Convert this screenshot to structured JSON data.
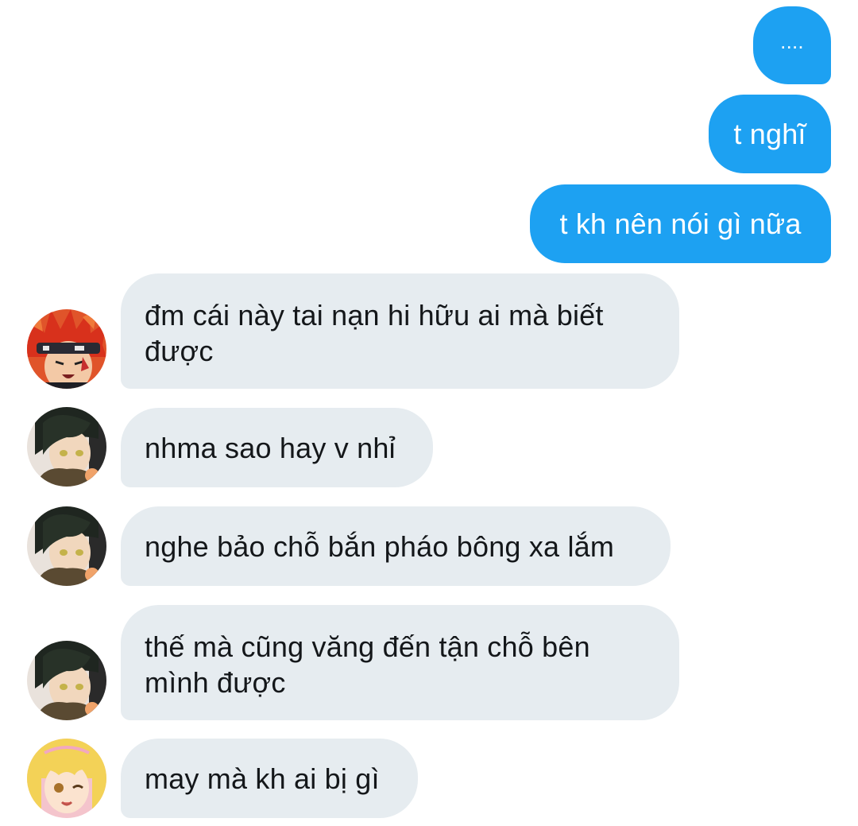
{
  "conversation": {
    "outgoing": [
      {
        "text": "...."
      },
      {
        "text": "t nghĩ"
      },
      {
        "text": "t kh nên nói gì nữa"
      }
    ],
    "incoming": [
      {
        "sender_avatar": "red-hair-headband-avatar",
        "text": "đm cái này tai nạn hi hữu ai mà biết được"
      },
      {
        "sender_avatar": "dark-hair-uniform-avatar",
        "text": "nhma sao hay v nhỉ"
      },
      {
        "sender_avatar": "dark-hair-uniform-avatar",
        "text": "nghe bảo chỗ bắn pháo bông xa lắm"
      },
      {
        "sender_avatar": "dark-hair-uniform-avatar",
        "text": "thế mà cũng văng đến tận chỗ bên mình được"
      },
      {
        "sender_avatar": "blonde-hair-avatar",
        "text": "may mà kh ai bị gì"
      }
    ]
  },
  "colors": {
    "outgoing_bubble": "#1da1f2",
    "incoming_bubble": "#e6ecf0",
    "incoming_text": "#14171a",
    "outgoing_text": "#ffffff"
  }
}
